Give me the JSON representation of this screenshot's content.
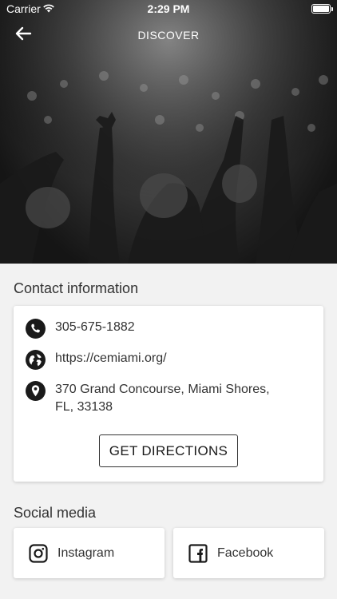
{
  "status_bar": {
    "carrier": "Carrier",
    "time": "2:29 PM"
  },
  "nav": {
    "title": "DISCOVER",
    "back_icon": "arrow-left-icon"
  },
  "contact": {
    "heading": "Contact information",
    "phone": "305-675-1882",
    "website": "https://cemiami.org/",
    "address": "370 Grand Concourse, Miami Shores, FL, 33138",
    "directions_label": "GET DIRECTIONS"
  },
  "social": {
    "heading": "Social media",
    "items": [
      {
        "label": "Instagram",
        "icon": "instagram-icon"
      },
      {
        "label": "Facebook",
        "icon": "facebook-icon"
      }
    ]
  },
  "colors": {
    "background": "#f2f2f2",
    "card": "#ffffff",
    "text": "#333333"
  }
}
